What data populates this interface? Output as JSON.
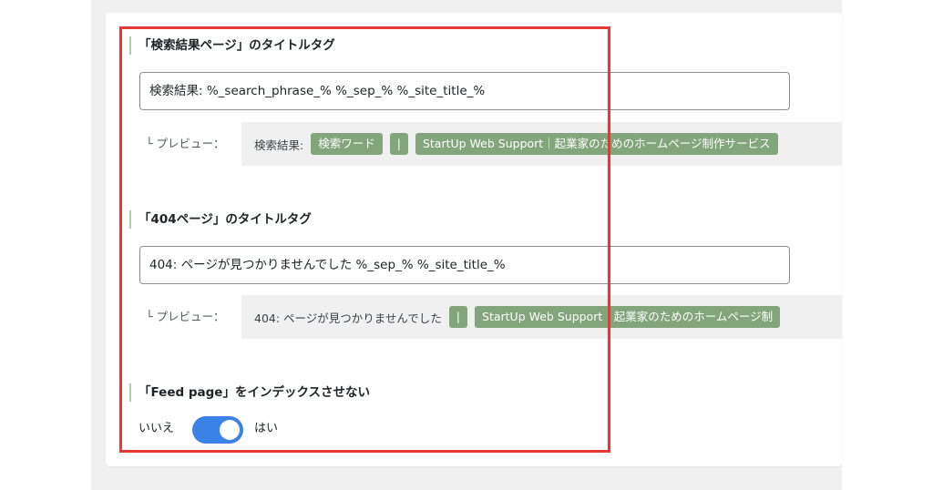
{
  "search_page": {
    "title": "「検索結果ページ」のタイトルタグ",
    "input_value": "検索結果: %_search_phrase_% %_sep_% %_site_title_%",
    "preview_label": "└ プレビュー：",
    "preview_text": "検索結果:",
    "preview_chips": [
      "検索ワード",
      "|",
      "StartUp Web Support｜起業家のためのホームページ制作サービス"
    ]
  },
  "notfound_page": {
    "title": "「404ページ」のタイトルタグ",
    "input_value": "404: ページが見つかりませんでした %_sep_% %_site_title_%",
    "preview_label": "└ プレビュー：",
    "preview_text": "404: ページが見つかりませんでした",
    "preview_chips": [
      "|",
      "StartUp Web Support｜起業家のためのホームページ制"
    ]
  },
  "feed_noindex": {
    "title": "「Feed page」をインデックスさせない",
    "no_label": "いいえ",
    "yes_label": "はい",
    "enabled": true
  },
  "colors": {
    "chip": "#82a57c",
    "toggle_on": "#3b82e6",
    "highlight": "#e53935",
    "section_bar": "#b7c9b1"
  }
}
